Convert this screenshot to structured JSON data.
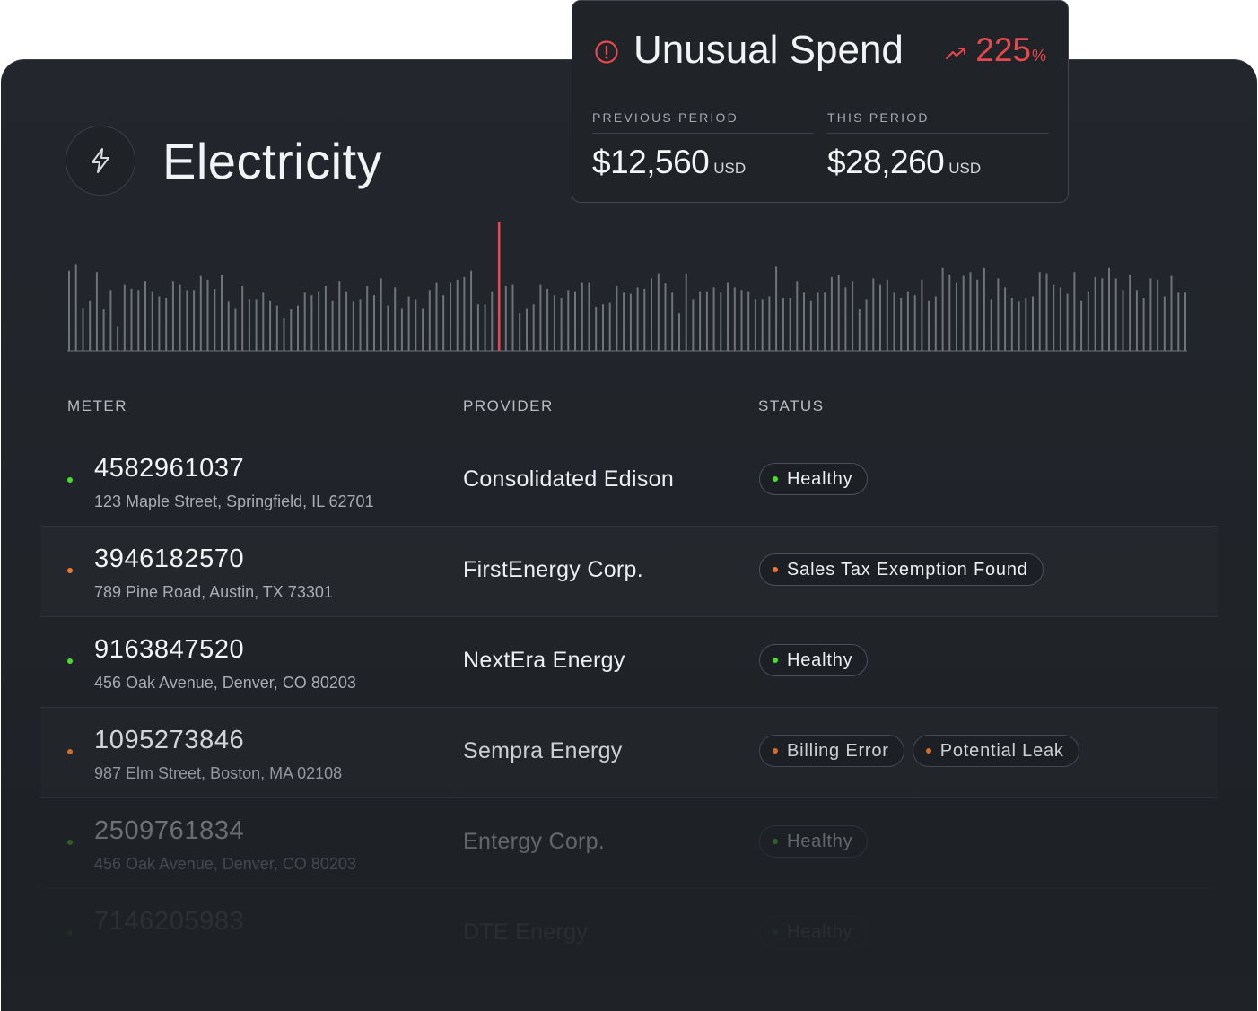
{
  "header": {
    "title": "Electricity",
    "icon": "lightning-bolt-icon"
  },
  "alert": {
    "title": "Unusual Spend",
    "icon": "info-icon",
    "change_icon": "trend-up-icon",
    "change_value": "225",
    "change_unit": "%",
    "accent_color": "#e5484d",
    "previous": {
      "label": "PREVIOUS PERIOD",
      "amount": "$12,560",
      "currency": "USD"
    },
    "current": {
      "label": "THIS PERIOD",
      "amount": "$28,260",
      "currency": "USD"
    }
  },
  "chart_data": {
    "type": "bar",
    "highlight_index": 62,
    "highlight_color": "#e5484d",
    "bar_color": "#6f737a",
    "values": [
      62,
      67,
      33,
      39,
      61,
      32,
      47,
      19,
      51,
      48,
      47,
      54,
      46,
      42,
      41,
      54,
      51,
      47,
      47,
      58,
      55,
      48,
      59,
      38,
      33,
      50,
      40,
      40,
      45,
      39,
      35,
      25,
      32,
      35,
      45,
      43,
      46,
      50,
      39,
      54,
      46,
      38,
      40,
      50,
      43,
      56,
      35,
      49,
      33,
      42,
      40,
      33,
      47,
      53,
      43,
      53,
      55,
      57,
      62,
      36,
      36,
      46,
      100,
      50,
      51,
      29,
      33,
      36,
      51,
      48,
      43,
      41,
      47,
      46,
      53,
      53,
      34,
      36,
      37,
      50,
      45,
      44,
      49,
      48,
      56,
      60,
      52,
      45,
      29,
      60,
      40,
      46,
      46,
      49,
      45,
      53,
      49,
      47,
      46,
      40,
      40,
      42,
      65,
      41,
      41,
      54,
      45,
      39,
      45,
      45,
      57,
      59,
      49,
      54,
      32,
      40,
      56,
      51,
      55,
      45,
      41,
      46,
      43,
      55,
      39,
      42,
      64,
      59,
      53,
      58,
      61,
      55,
      64,
      40,
      56,
      49,
      41,
      38,
      41,
      42,
      61,
      60,
      51,
      49,
      44,
      61,
      39,
      46,
      57,
      56,
      64,
      56,
      47,
      59,
      47,
      41,
      56,
      55,
      42,
      58,
      45,
      45
    ]
  },
  "table": {
    "headers": {
      "meter": "METER",
      "provider": "PROVIDER",
      "status": "STATUS"
    },
    "status_colors": {
      "ok": "#4ade2a",
      "warn": "#f07a34"
    },
    "rows": [
      {
        "meter_id": "4582961037",
        "address": "123 Maple Street, Springfield, IL 62701",
        "provider": "Consolidated Edison",
        "indicator": "ok",
        "badges": [
          {
            "label": "Healthy",
            "kind": "ok"
          }
        ]
      },
      {
        "meter_id": "3946182570",
        "address": "789 Pine Road, Austin, TX 73301",
        "provider": "FirstEnergy Corp.",
        "indicator": "warn",
        "badges": [
          {
            "label": "Sales Tax Exemption Found",
            "kind": "warn"
          }
        ]
      },
      {
        "meter_id": "9163847520",
        "address": "456 Oak Avenue, Denver, CO 80203",
        "provider": "NextEra Energy",
        "indicator": "ok",
        "badges": [
          {
            "label": "Healthy",
            "kind": "ok"
          }
        ]
      },
      {
        "meter_id": "1095273846",
        "address": "987 Elm Street, Boston, MA 02108",
        "provider": "Sempra Energy",
        "indicator": "warn",
        "badges": [
          {
            "label": "Billing Error",
            "kind": "warn"
          },
          {
            "label": "Potential Leak",
            "kind": "warn"
          }
        ]
      },
      {
        "meter_id": "2509761834",
        "address": "456 Oak Avenue, Denver, CO 80203",
        "provider": "Entergy Corp.",
        "indicator": "ok",
        "badges": [
          {
            "label": "Healthy",
            "kind": "ok"
          }
        ]
      },
      {
        "meter_id": "7146205983",
        "address": "",
        "provider": "DTE Energy",
        "indicator": "ok",
        "badges": [
          {
            "label": "Healthy",
            "kind": "ok"
          }
        ]
      }
    ]
  }
}
